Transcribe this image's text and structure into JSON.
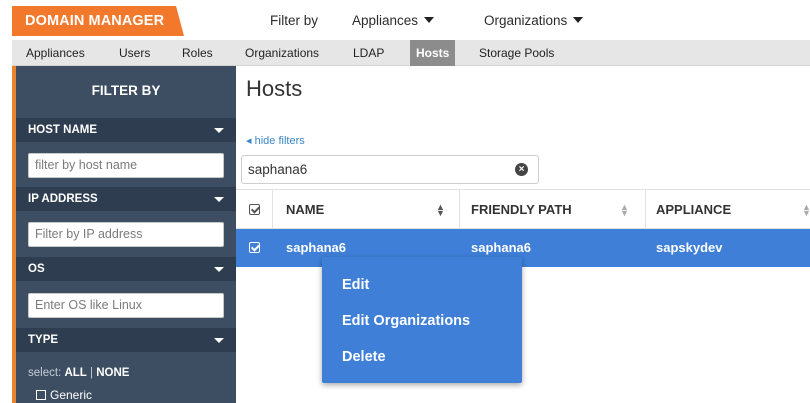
{
  "app": {
    "brand": "DOMAIN MANAGER"
  },
  "topmenu": {
    "filter_by": "Filter by",
    "appliances": "Appliances",
    "organizations": "Organizations"
  },
  "nav": {
    "items": [
      "Appliances",
      "Users",
      "Roles",
      "Organizations",
      "LDAP",
      "Hosts",
      "Storage Pools"
    ],
    "active": "Hosts"
  },
  "sidebar": {
    "title": "FILTER BY",
    "sections": [
      {
        "label": "HOST NAME",
        "placeholder": "filter by host name"
      },
      {
        "label": "IP ADDRESS",
        "placeholder": "Filter by IP address"
      },
      {
        "label": "OS",
        "placeholder": "Enter OS like Linux"
      },
      {
        "label": "TYPE"
      }
    ],
    "select_prefix": "select:",
    "select_all": "ALL",
    "select_sep": "|",
    "select_none": "NONE",
    "type_options": [
      "Generic"
    ]
  },
  "main": {
    "title": "Hosts",
    "hide_filters": "hide filters",
    "search_value": "saphana6",
    "columns": [
      "NAME",
      "FRIENDLY PATH",
      "APPLIANCE"
    ],
    "rows": [
      {
        "name": "saphana6",
        "friendly_path": "saphana6",
        "appliance": "sapskydev",
        "selected": true
      }
    ]
  },
  "context_menu": {
    "items": [
      "Edit",
      "Edit Organizations",
      "Delete"
    ]
  },
  "colors": {
    "brand": "#f2782c",
    "sidebar": "#3d4e62",
    "sidebar_header": "#2e3d50",
    "selection": "#3f7fd8",
    "link": "#3b85c6"
  }
}
